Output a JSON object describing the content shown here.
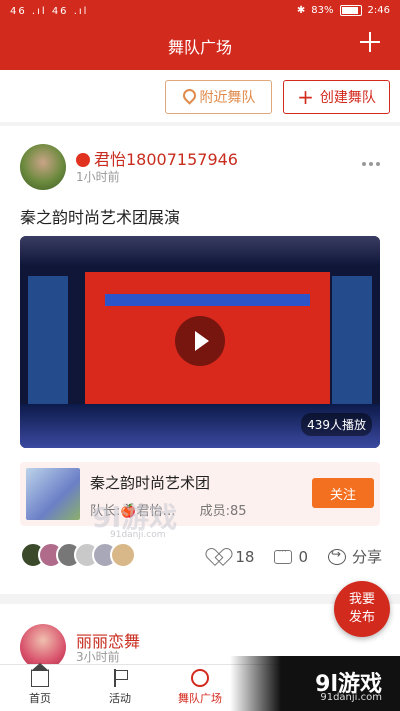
{
  "status_bar": {
    "signal": "46 .ıl 46 .ıl",
    "battery_percent": "83%",
    "time": "2:46"
  },
  "header": {
    "title": "舞队广场"
  },
  "actions": {
    "nearby_label": "附近舞队",
    "create_label": "创建舞队"
  },
  "post": {
    "username": "君怡18007157946",
    "time": "1小时前",
    "title": "秦之韵时尚艺术团展演",
    "video": {
      "views": "439人播放"
    },
    "team": {
      "name": "秦之韵时尚艺术团",
      "captain": "队长:🍎君怡…",
      "members": "成员:85",
      "follow_label": "关注"
    },
    "likes": "18",
    "comments": "0",
    "share_label": "分享"
  },
  "post2": {
    "username": "丽丽恋舞",
    "time": "3小时前"
  },
  "publish": {
    "line1": "我要",
    "line2": "发布"
  },
  "nav": [
    {
      "label": "首页"
    },
    {
      "label": "活动"
    },
    {
      "label": "舞队广场"
    }
  ],
  "watermark": {
    "main": "9l游戏",
    "sub": "91danji.com",
    "center": "9l游戏",
    "center_sub": "91danji.com"
  },
  "colors": {
    "brand_red": "#d32a1e",
    "follow_orange": "#f37021",
    "nearby_orange": "#e08a4b"
  }
}
